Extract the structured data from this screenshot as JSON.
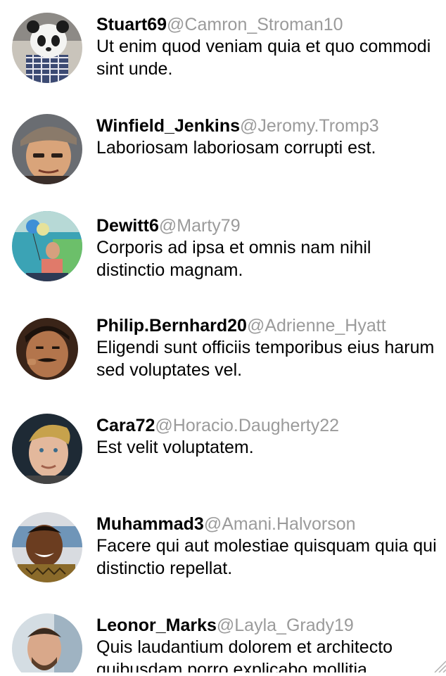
{
  "feed": {
    "items": [
      {
        "username": "Stuart69",
        "handle": "@Camron_Stroman10",
        "text": "Ut enim quod veniam quia et quo commodi sint unde.",
        "avatar": "panda-mask-avatar"
      },
      {
        "username": "Winfield_Jenkins",
        "handle": "@Jeromy.Tromp3",
        "text": "Laboriosam laboriosam corrupti est.",
        "avatar": "cap-man-avatar"
      },
      {
        "username": "Dewitt6",
        "handle": "@Marty79",
        "text": "Corporis ad ipsa et omnis nam nihil distinctio magnam.",
        "avatar": "balloons-man-avatar"
      },
      {
        "username": "Philip.Bernhard20",
        "handle": "@Adrienne_Hyatt",
        "text": "Eligendi sunt officiis temporibus eius harum sed voluptates vel.",
        "avatar": "mustache-man-avatar"
      },
      {
        "username": "Cara72",
        "handle": "@Horacio.Daugherty22",
        "text": "Est velit voluptatem.",
        "avatar": "blond-man-avatar"
      },
      {
        "username": "Muhammad3",
        "handle": "@Amani.Halvorson",
        "text": "Facere qui aut molestiae quisquam quia qui distinctio repellat.",
        "avatar": "smiling-man-avatar"
      },
      {
        "username": "Leonor_Marks",
        "handle": "@Layla_Grady19",
        "text": "Quis laudantium dolorem et architecto quibusdam porro explicabo mollitia",
        "avatar": "bearded-man-avatar"
      }
    ]
  },
  "colors": {
    "username": "#000000",
    "handle": "#9b9b9b",
    "text": "#000000",
    "background": "#ffffff"
  }
}
